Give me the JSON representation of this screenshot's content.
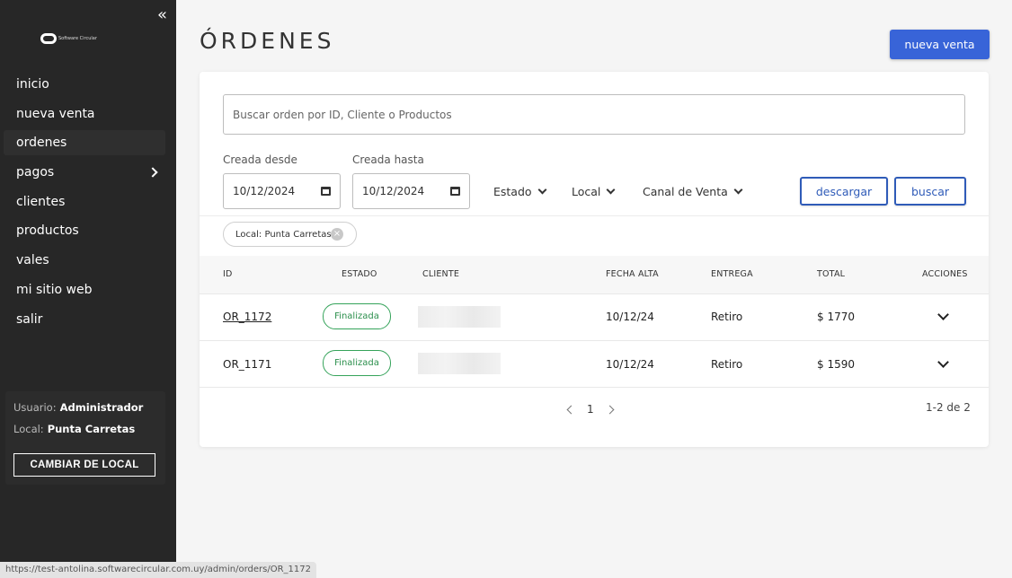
{
  "sidebar": {
    "collapse_glyph": "«",
    "logo_text": "Software Circular",
    "items": [
      {
        "label": "inicio"
      },
      {
        "label": "nueva venta"
      },
      {
        "label": "ordenes"
      },
      {
        "label": "pagos"
      },
      {
        "label": "clientes"
      },
      {
        "label": "productos"
      },
      {
        "label": "vales"
      },
      {
        "label": "mi sitio web"
      },
      {
        "label": "salir"
      }
    ],
    "user_label": "Usuario:",
    "user_value": "Administrador",
    "local_label": "Local:",
    "local_value": "Punta Carretas",
    "change_local_button": "CAMBIAR DE LOCAL"
  },
  "header": {
    "title": "ÓRDENES",
    "new_sale_button": "nueva venta"
  },
  "filters": {
    "search_placeholder": "Buscar orden por ID, Cliente o Productos",
    "from_label": "Creada desde",
    "from_value": "10/12/2024",
    "to_label": "Creada hasta",
    "to_value": "10/12/2024",
    "estado": "Estado",
    "local": "Local",
    "canal": "Canal de Venta",
    "download_button": "descargar",
    "search_button": "buscar",
    "active_chip": "Local: Punta Carretas"
  },
  "table": {
    "headers": {
      "id": "ID",
      "estado": "ESTADO",
      "cliente": "CLIENTE",
      "fecha": "FECHA ALTA",
      "entrega": "ENTREGA",
      "total": "TOTAL",
      "acciones": "ACCIONES"
    },
    "rows": [
      {
        "id": "OR_1172",
        "estado": "Finalizada",
        "fecha": "10/12/24",
        "entrega": "Retiro",
        "total": "$ 1770"
      },
      {
        "id": "OR_1171",
        "estado": "Finalizada",
        "fecha": "10/12/24",
        "entrega": "Retiro",
        "total": "$ 1590"
      }
    ]
  },
  "pagination": {
    "page": "1",
    "count": "1-2 de 2"
  },
  "status_bar_url": "https://test-antolina.softwarecircular.com.uy/admin/orders/OR_1172",
  "colors": {
    "sidebar_bg": "#272727",
    "primary": "#3864d8",
    "badge_green": "#2b8f4c"
  }
}
